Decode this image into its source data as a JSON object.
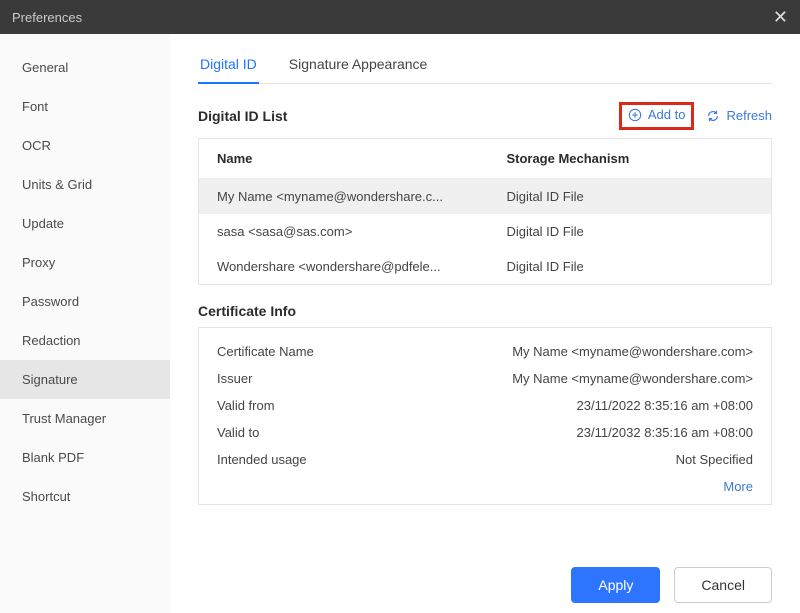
{
  "window": {
    "title": "Preferences"
  },
  "sidebar": {
    "items": [
      {
        "label": "General"
      },
      {
        "label": "Font"
      },
      {
        "label": "OCR"
      },
      {
        "label": "Units & Grid"
      },
      {
        "label": "Update"
      },
      {
        "label": "Proxy"
      },
      {
        "label": "Password"
      },
      {
        "label": "Redaction"
      },
      {
        "label": "Signature",
        "active": true
      },
      {
        "label": "Trust Manager"
      },
      {
        "label": "Blank PDF"
      },
      {
        "label": "Shortcut"
      }
    ]
  },
  "tabs": [
    {
      "label": "Digital ID",
      "active": true
    },
    {
      "label": "Signature Appearance"
    }
  ],
  "digital_id_list": {
    "title": "Digital ID List",
    "add_label": "Add to",
    "refresh_label": "Refresh",
    "columns": {
      "name": "Name",
      "storage": "Storage Mechanism"
    },
    "rows": [
      {
        "name": "My Name <myname@wondershare.c...",
        "storage": "Digital ID File",
        "selected": true
      },
      {
        "name": "sasa <sasa@sas.com>",
        "storage": "Digital ID File"
      },
      {
        "name": "Wondershare <wondershare@pdfele...",
        "storage": "Digital ID File"
      }
    ]
  },
  "certificate_info": {
    "title": "Certificate Info",
    "rows": [
      {
        "label": "Certificate Name",
        "value": "My Name <myname@wondershare.com>"
      },
      {
        "label": "Issuer",
        "value": "My Name <myname@wondershare.com>"
      },
      {
        "label": "Valid from",
        "value": "23/11/2022 8:35:16 am +08:00"
      },
      {
        "label": "Valid to",
        "value": "23/11/2032 8:35:16 am +08:00"
      },
      {
        "label": "Intended usage",
        "value": "Not Specified"
      }
    ],
    "more_label": "More"
  },
  "footer": {
    "apply": "Apply",
    "cancel": "Cancel"
  }
}
